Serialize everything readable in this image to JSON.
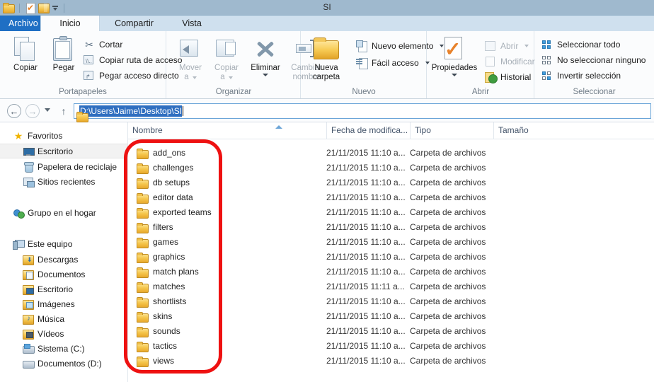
{
  "window": {
    "title": "SI",
    "quick_access": [
      "folder-icon",
      "document-check-icon",
      "folder-open-icon",
      "chevron-down-icon"
    ]
  },
  "ribbon": {
    "tabs": [
      {
        "label": "Archivo",
        "kind": "file"
      },
      {
        "label": "Inicio",
        "kind": "active"
      },
      {
        "label": "Compartir",
        "kind": "normal"
      },
      {
        "label": "Vista",
        "kind": "normal"
      }
    ],
    "groups": [
      {
        "name": "Portapapeles",
        "label": "Portapapeles",
        "big": [
          {
            "label": "Copiar",
            "icon": "copy-icon"
          },
          {
            "label": "Pegar",
            "icon": "paste-icon"
          }
        ],
        "small": [
          {
            "label": "Cortar",
            "icon": "scissors-icon",
            "dim": false
          },
          {
            "label": "Copiar ruta de acceso",
            "icon": "copy-path-icon",
            "dim": false
          },
          {
            "label": "Pegar acceso directo",
            "icon": "paste-shortcut-icon",
            "dim": false
          }
        ]
      },
      {
        "name": "Organizar",
        "label": "Organizar",
        "big": [
          {
            "label_line1": "Mover",
            "label_line2": "a",
            "icon": "move-to-icon",
            "dim": true,
            "caret": true
          },
          {
            "label_line1": "Copiar",
            "label_line2": "a",
            "icon": "copy-to-icon",
            "dim": true,
            "caret": true
          },
          {
            "label_line1": "Eliminar",
            "label_line2": "",
            "icon": "delete-icon",
            "dim": false,
            "caret": true
          },
          {
            "label_line1": "Cambiar",
            "label_line2": "nombre",
            "icon": "rename-icon",
            "dim": true,
            "caret": false
          }
        ]
      },
      {
        "name": "Nuevo",
        "label": "Nuevo",
        "big": [
          {
            "label_line1": "Nueva",
            "label_line2": "carpeta",
            "icon": "new-folder-icon"
          }
        ],
        "small": [
          {
            "label": "Nuevo elemento",
            "icon": "new-item-icon",
            "caret": true
          },
          {
            "label": "Fácil acceso",
            "icon": "easy-access-icon",
            "caret": true
          }
        ]
      },
      {
        "name": "Abrir",
        "label": "Abrir",
        "big": [
          {
            "label_line1": "Propiedades",
            "label_line2": "",
            "icon": "properties-icon",
            "caret": true
          }
        ],
        "small": [
          {
            "label": "Abrir",
            "icon": "open-icon",
            "dim": true,
            "caret": true
          },
          {
            "label": "Modificar",
            "icon": "edit-icon",
            "dim": true,
            "caret": false
          },
          {
            "label": "Historial",
            "icon": "history-icon",
            "dim": false,
            "caret": false
          }
        ]
      },
      {
        "name": "Seleccionar",
        "label": "Seleccionar",
        "small": [
          {
            "label": "Seleccionar todo",
            "icon": "select-all-icon"
          },
          {
            "label": "No seleccionar ninguno",
            "icon": "select-none-icon"
          },
          {
            "label": "Invertir selección",
            "icon": "invert-selection-icon"
          }
        ]
      }
    ]
  },
  "addressbar": {
    "back_glyph": "←",
    "forward_glyph": "→",
    "up_glyph": "↑",
    "path": "D:\\Users\\Jaime\\Desktop\\SI",
    "folder_icon": "folder-icon"
  },
  "sidebar": {
    "sections": [
      {
        "header": {
          "label": "Favoritos",
          "icon": "star-icon"
        },
        "items": [
          {
            "label": "Escritorio",
            "icon": "desktop-icon",
            "selected": true
          },
          {
            "label": "Papelera de reciclaje",
            "icon": "recycle-bin-icon",
            "selected": false
          },
          {
            "label": "Sitios recientes",
            "icon": "recent-places-icon",
            "selected": false
          }
        ]
      },
      {
        "header": {
          "label": "Grupo en el hogar",
          "icon": "homegroup-icon"
        },
        "items": []
      },
      {
        "header": {
          "label": "Este equipo",
          "icon": "this-pc-icon"
        },
        "items": [
          {
            "label": "Descargas",
            "icon": "downloads-folder-icon",
            "selected": false
          },
          {
            "label": "Documentos",
            "icon": "documents-folder-icon",
            "selected": false
          },
          {
            "label": "Escritorio",
            "icon": "desktop-folder-icon",
            "selected": false
          },
          {
            "label": "Imágenes",
            "icon": "pictures-folder-icon",
            "selected": false
          },
          {
            "label": "Música",
            "icon": "music-folder-icon",
            "selected": false
          },
          {
            "label": "Vídeos",
            "icon": "videos-folder-icon",
            "selected": false
          },
          {
            "label": "Sistema (C:)",
            "icon": "system-drive-icon",
            "selected": false
          },
          {
            "label": "Documentos (D:)",
            "icon": "drive-icon",
            "selected": false
          }
        ]
      }
    ]
  },
  "filelist": {
    "columns": [
      {
        "label": "Nombre",
        "sorted": true
      },
      {
        "label": "Fecha de modifica...",
        "sorted": false
      },
      {
        "label": "Tipo",
        "sorted": false
      },
      {
        "label": "Tamaño",
        "sorted": false
      }
    ],
    "rows": [
      {
        "name": "add_ons",
        "date": "21/11/2015 11:10 a...",
        "type": "Carpeta de archivos",
        "size": ""
      },
      {
        "name": "challenges",
        "date": "21/11/2015 11:10 a...",
        "type": "Carpeta de archivos",
        "size": ""
      },
      {
        "name": "db setups",
        "date": "21/11/2015 11:10 a...",
        "type": "Carpeta de archivos",
        "size": ""
      },
      {
        "name": "editor data",
        "date": "21/11/2015 11:10 a...",
        "type": "Carpeta de archivos",
        "size": ""
      },
      {
        "name": "exported teams",
        "date": "21/11/2015 11:10 a...",
        "type": "Carpeta de archivos",
        "size": ""
      },
      {
        "name": "filters",
        "date": "21/11/2015 11:10 a...",
        "type": "Carpeta de archivos",
        "size": ""
      },
      {
        "name": "games",
        "date": "21/11/2015 11:10 a...",
        "type": "Carpeta de archivos",
        "size": ""
      },
      {
        "name": "graphics",
        "date": "21/11/2015 11:10 a...",
        "type": "Carpeta de archivos",
        "size": ""
      },
      {
        "name": "match plans",
        "date": "21/11/2015 11:10 a...",
        "type": "Carpeta de archivos",
        "size": ""
      },
      {
        "name": "matches",
        "date": "21/11/2015 11:11 a...",
        "type": "Carpeta de archivos",
        "size": ""
      },
      {
        "name": "shortlists",
        "date": "21/11/2015 11:10 a...",
        "type": "Carpeta de archivos",
        "size": ""
      },
      {
        "name": "skins",
        "date": "21/11/2015 11:10 a...",
        "type": "Carpeta de archivos",
        "size": ""
      },
      {
        "name": "sounds",
        "date": "21/11/2015 11:10 a...",
        "type": "Carpeta de archivos",
        "size": ""
      },
      {
        "name": "tactics",
        "date": "21/11/2015 11:10 a...",
        "type": "Carpeta de archivos",
        "size": ""
      },
      {
        "name": "views",
        "date": "21/11/2015 11:10 a...",
        "type": "Carpeta de archivos",
        "size": ""
      }
    ]
  },
  "annotation": {
    "shape": "rounded-rectangle",
    "color": "#ee1111"
  }
}
